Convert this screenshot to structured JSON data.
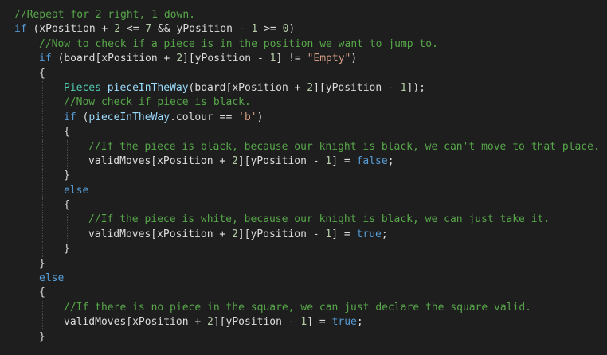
{
  "editor": {
    "theme_colors": {
      "background": "#1e1e1e",
      "comment": "#57a64a",
      "keyword": "#569cd6",
      "type": "#4ec9b0",
      "string": "#d69d85",
      "number": "#b5cea8",
      "identifier": "#dcdcdc",
      "local": "#9cdcfe"
    },
    "lines": [
      {
        "indent": 0,
        "guides": [],
        "tokens": [
          {
            "t": "//Repeat for 2 right, 1 down.",
            "k": "comment"
          }
        ]
      },
      {
        "indent": 0,
        "guides": [],
        "tokens": [
          {
            "t": "if",
            "k": "keyword"
          },
          {
            "t": " (xPosition + ",
            "k": "ident"
          },
          {
            "t": "2",
            "k": "number"
          },
          {
            "t": " <= ",
            "k": "ident"
          },
          {
            "t": "7",
            "k": "number"
          },
          {
            "t": " && yPosition - ",
            "k": "ident"
          },
          {
            "t": "1",
            "k": "number"
          },
          {
            "t": " >= ",
            "k": "ident"
          },
          {
            "t": "0",
            "k": "number"
          },
          {
            "t": ")",
            "k": "ident"
          }
        ]
      },
      {
        "indent": 1,
        "guides": [],
        "tokens": [
          {
            "t": "//Now to check if a piece is in the position we want to jump to.",
            "k": "comment"
          }
        ]
      },
      {
        "indent": 1,
        "guides": [],
        "tokens": [
          {
            "t": "if",
            "k": "keyword"
          },
          {
            "t": " (board[xPosition + ",
            "k": "ident"
          },
          {
            "t": "2",
            "k": "number"
          },
          {
            "t": "][yPosition - ",
            "k": "ident"
          },
          {
            "t": "1",
            "k": "number"
          },
          {
            "t": "] != ",
            "k": "ident"
          },
          {
            "t": "\"Empty\"",
            "k": "string"
          },
          {
            "t": ")",
            "k": "ident"
          }
        ]
      },
      {
        "indent": 1,
        "guides": [],
        "tokens": [
          {
            "t": "{",
            "k": "ident"
          }
        ]
      },
      {
        "indent": 2,
        "guides": [
          1
        ],
        "tokens": [
          {
            "t": "Pieces",
            "k": "type"
          },
          {
            "t": " ",
            "k": "ident"
          },
          {
            "t": "pieceInTheWay",
            "k": "local"
          },
          {
            "t": "(board[xPosition + ",
            "k": "ident"
          },
          {
            "t": "2",
            "k": "number"
          },
          {
            "t": "][yPosition - ",
            "k": "ident"
          },
          {
            "t": "1",
            "k": "number"
          },
          {
            "t": "]);",
            "k": "ident"
          }
        ]
      },
      {
        "indent": 2,
        "guides": [
          1
        ],
        "tokens": [
          {
            "t": "//Now check if piece is black.",
            "k": "comment"
          }
        ]
      },
      {
        "indent": 2,
        "guides": [
          1
        ],
        "tokens": [
          {
            "t": "if",
            "k": "keyword"
          },
          {
            "t": " (",
            "k": "ident"
          },
          {
            "t": "pieceInTheWay",
            "k": "local"
          },
          {
            "t": ".colour == ",
            "k": "ident"
          },
          {
            "t": "'b'",
            "k": "string"
          },
          {
            "t": ")",
            "k": "ident"
          }
        ]
      },
      {
        "indent": 2,
        "guides": [
          1
        ],
        "tokens": [
          {
            "t": "{",
            "k": "ident"
          }
        ]
      },
      {
        "indent": 3,
        "guides": [
          1,
          2
        ],
        "tokens": [
          {
            "t": "//If the piece is black, because our knight is black, we can't move to that place.",
            "k": "comment"
          }
        ]
      },
      {
        "indent": 3,
        "guides": [
          1,
          2
        ],
        "tokens": [
          {
            "t": "validMoves[xPosition + ",
            "k": "ident"
          },
          {
            "t": "2",
            "k": "number"
          },
          {
            "t": "][yPosition - ",
            "k": "ident"
          },
          {
            "t": "1",
            "k": "number"
          },
          {
            "t": "] = ",
            "k": "ident"
          },
          {
            "t": "false",
            "k": "keyword"
          },
          {
            "t": ";",
            "k": "ident"
          }
        ]
      },
      {
        "indent": 2,
        "guides": [
          1
        ],
        "tokens": [
          {
            "t": "}",
            "k": "ident"
          }
        ]
      },
      {
        "indent": 2,
        "guides": [
          1
        ],
        "tokens": [
          {
            "t": "else",
            "k": "keyword"
          }
        ]
      },
      {
        "indent": 2,
        "guides": [
          1
        ],
        "tokens": [
          {
            "t": "{",
            "k": "ident"
          }
        ]
      },
      {
        "indent": 3,
        "guides": [
          1,
          2
        ],
        "tokens": [
          {
            "t": "//If the piece is white, because our knight is black, we can just take it.",
            "k": "comment"
          }
        ]
      },
      {
        "indent": 3,
        "guides": [
          1,
          2
        ],
        "tokens": [
          {
            "t": "validMoves[xPosition + ",
            "k": "ident"
          },
          {
            "t": "2",
            "k": "number"
          },
          {
            "t": "][yPosition - ",
            "k": "ident"
          },
          {
            "t": "1",
            "k": "number"
          },
          {
            "t": "] = ",
            "k": "ident"
          },
          {
            "t": "true",
            "k": "keyword"
          },
          {
            "t": ";",
            "k": "ident"
          }
        ]
      },
      {
        "indent": 2,
        "guides": [
          1
        ],
        "tokens": [
          {
            "t": "}",
            "k": "ident"
          }
        ]
      },
      {
        "indent": 1,
        "guides": [],
        "tokens": [
          {
            "t": "}",
            "k": "ident"
          }
        ]
      },
      {
        "indent": 1,
        "guides": [],
        "tokens": [
          {
            "t": "else",
            "k": "keyword"
          }
        ]
      },
      {
        "indent": 1,
        "guides": [],
        "tokens": [
          {
            "t": "{",
            "k": "ident"
          }
        ]
      },
      {
        "indent": 2,
        "guides": [
          1
        ],
        "tokens": [
          {
            "t": "//If there is no piece in the square, we can just declare the square valid.",
            "k": "comment"
          }
        ]
      },
      {
        "indent": 2,
        "guides": [
          1
        ],
        "tokens": [
          {
            "t": "validMoves[xPosition + ",
            "k": "ident"
          },
          {
            "t": "2",
            "k": "number"
          },
          {
            "t": "][yPosition - ",
            "k": "ident"
          },
          {
            "t": "1",
            "k": "number"
          },
          {
            "t": "] = ",
            "k": "ident"
          },
          {
            "t": "true",
            "k": "keyword"
          },
          {
            "t": ";",
            "k": "ident"
          }
        ]
      },
      {
        "indent": 1,
        "guides": [],
        "tokens": [
          {
            "t": "}",
            "k": "ident"
          }
        ]
      }
    ]
  }
}
